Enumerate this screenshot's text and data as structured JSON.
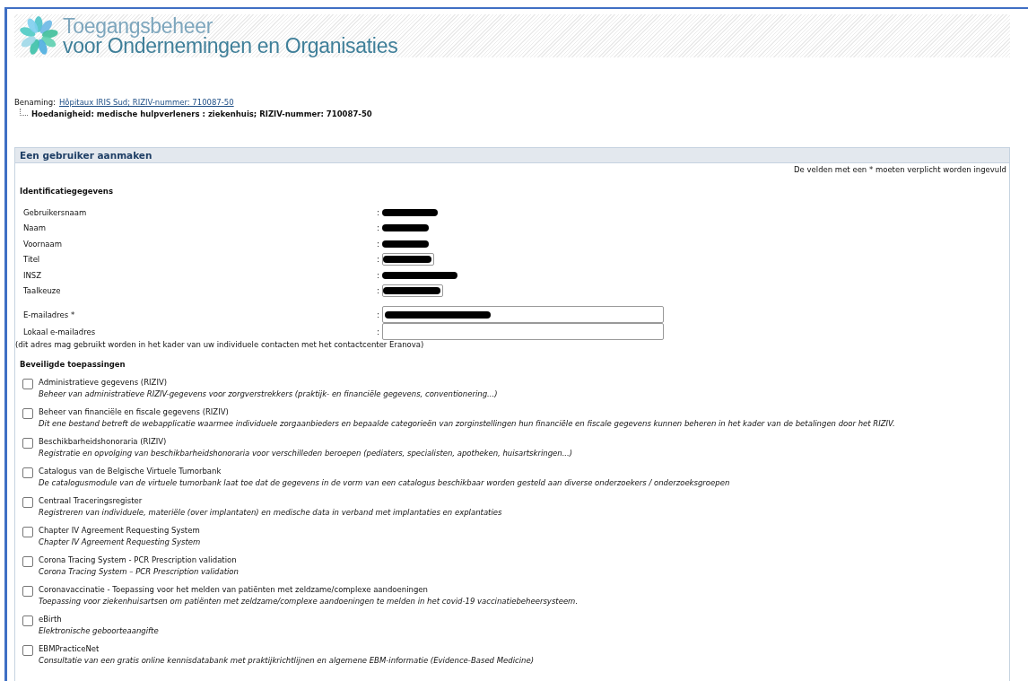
{
  "header": {
    "title_line_1": "Toegangsbeheer",
    "title_line_2": "voor Ondernemingen en Organisaties"
  },
  "breadcrumb": {
    "label": "Benaming:",
    "link": "Hôpitaux IRIS Sud; RIZIV-nummer: 710087-50",
    "child": "Hoedanigheid: medische hulpverleners : ziekenhuis; RIZIV-nummer: 710087-50"
  },
  "panel": {
    "title": "Een gebruiker aanmaken",
    "required_note": "De velden met een * moeten verplicht worden ingevuld",
    "identification": {
      "heading": "Identificatiegegevens",
      "rows": [
        {
          "label": "Gebruikersnaam",
          "separator": ":",
          "kind": "plain",
          "redacted": true
        },
        {
          "label": "Naam",
          "separator": ":",
          "kind": "plain",
          "redacted": true
        },
        {
          "label": "Voornaam",
          "separator": ":",
          "kind": "plain",
          "redacted": true
        },
        {
          "label": "Titel",
          "separator": ":",
          "kind": "boxed",
          "redacted": true
        },
        {
          "label": "INSZ",
          "separator": ":",
          "kind": "plain",
          "redacted": true
        },
        {
          "label": "Taalkeuze",
          "separator": ":",
          "kind": "boxed",
          "redacted": true
        }
      ]
    },
    "email_rows": [
      {
        "label": "E-mailadres *",
        "separator": ":",
        "redacted": true
      },
      {
        "label": "Lokaal e-mailadres",
        "separator": ":",
        "redacted": false
      }
    ],
    "email_note": "(dit adres mag gebruikt worden in het kader van uw individuele contacten met het contactcenter Eranova)",
    "applications": {
      "heading": "Beveiligde toepassingen",
      "items": [
        {
          "name": "Administratieve gegevens (RIZIV)",
          "description": "Beheer van administratieve RIZIV-gegevens voor zorgverstrekkers (praktijk- en financiële gegevens, conventionering...)",
          "checked": false
        },
        {
          "name": "Beheer van financiële en fiscale gegevens (RIZIV)",
          "description": "Dit ene bestand betreft de webapplicatie waarmee individuele zorgaanbieders en bepaalde categorieën van zorginstellingen hun financiële en fiscale gegevens kunnen beheren in het kader van de betalingen door het RIZIV.",
          "checked": false
        },
        {
          "name": "Beschikbarheidshonoraria (RIZIV)",
          "description": "Registratie en opvolging van beschikbarheidshonoraria voor verschilleden beroepen (pediaters, specialisten, apotheken, huisartskringen...)",
          "checked": false
        },
        {
          "name": "Catalogus van de Belgische Virtuele Tumorbank",
          "description": "De catalogusmodule van de virtuele tumorbank laat toe dat de gegevens in de vorm van een catalogus beschikbaar worden gesteld aan diverse onderzoekers / onderzoeksgroepen",
          "checked": false
        },
        {
          "name": "Centraal Traceringsregister",
          "description": "Registreren van individuele, materiële (over implantaten) en medische data in verband met implantaties en explantaties",
          "checked": false
        },
        {
          "name": "Chapter IV Agreement Requesting System",
          "description": "Chapter IV Agreement Requesting System",
          "checked": false
        },
        {
          "name": "Corona Tracing System - PCR Prescription validation",
          "description": "Corona Tracing System – PCR Prescription validation",
          "checked": false
        },
        {
          "name": "Coronavaccinatie - Toepassing voor het melden van patiënten met zeldzame/complexe aandoeningen",
          "description": "Toepassing voor ziekenhuisartsen om patiënten met zeldzame/complexe aandoeningen te melden in het covid-19 vaccinatiebeheersysteem.",
          "checked": false
        },
        {
          "name": "eBirth",
          "description": "Elektronische geboorteaangifte",
          "checked": false
        },
        {
          "name": "EBMPracticeNet",
          "description": "Consultatie van een gratis online kennisdatabank met praktijkrichtlijnen en algemene EBM-informatie (Evidence-Based Medicine)",
          "checked": false
        }
      ]
    }
  }
}
